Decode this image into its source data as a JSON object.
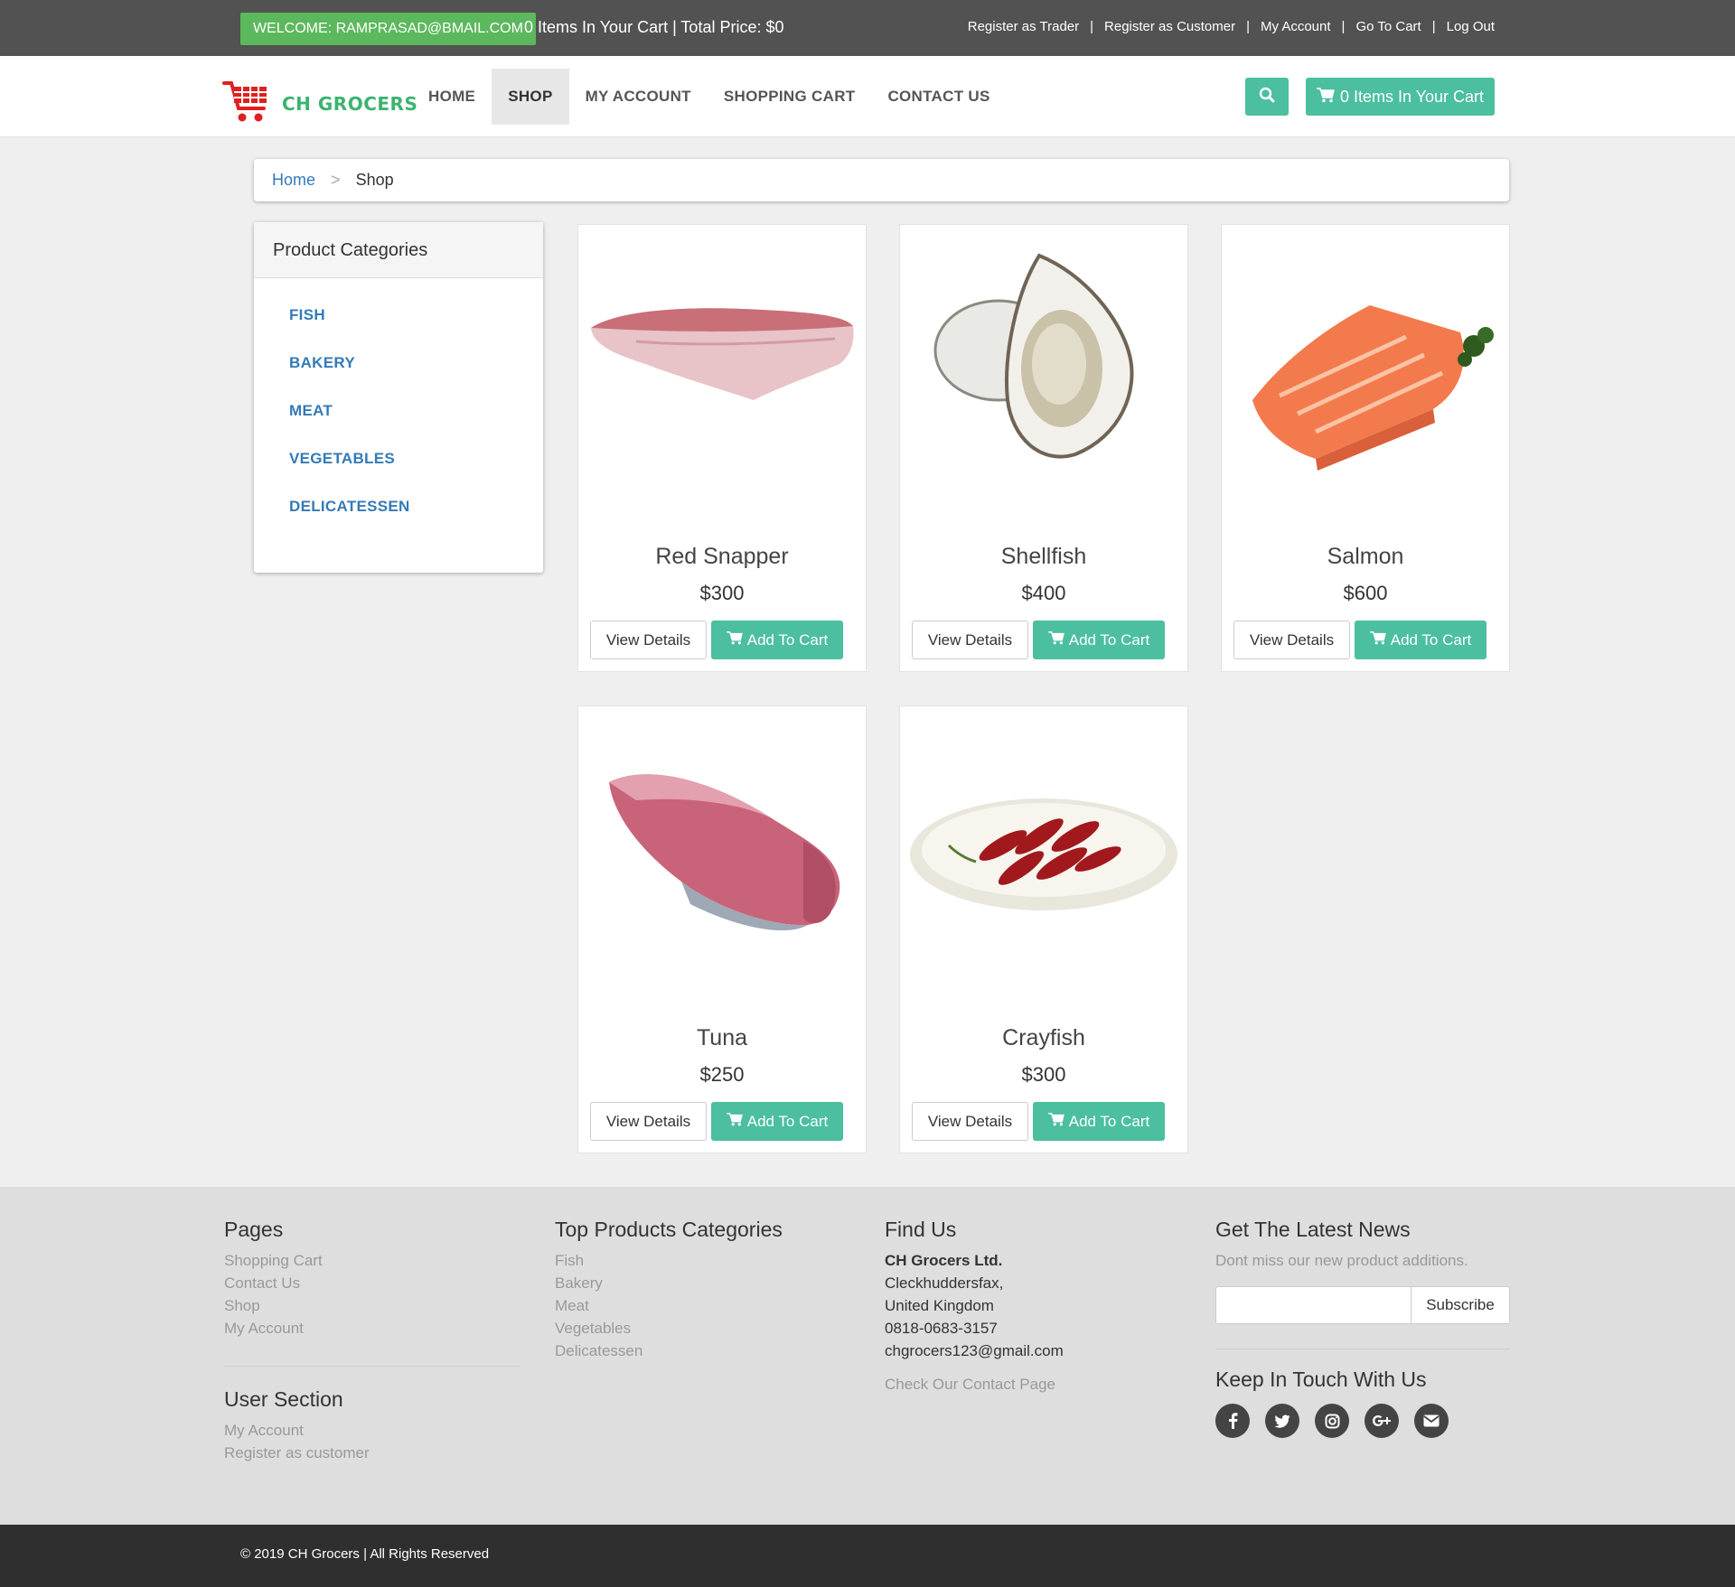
{
  "topbar": {
    "welcome": "WELCOME: RAMPRASAD@BMAIL.COM",
    "cart_summary": "0 Items In Your Cart | Total Price: $0",
    "links": [
      "Register as Trader",
      "Register as Customer",
      "My Account",
      "Go To Cart",
      "Log Out"
    ],
    "separator": "|"
  },
  "nav": {
    "brand": "CH GROCERS",
    "menu": [
      "HOME",
      "SHOP",
      "MY ACCOUNT",
      "SHOPPING CART",
      "CONTACT US"
    ],
    "active": "SHOP",
    "cart_button": "0 Items In Your Cart"
  },
  "breadcrumb": {
    "home": "Home",
    "separator": ">",
    "current": "Shop"
  },
  "sidebar": {
    "title": "Product Categories",
    "categories": [
      "FISH",
      "BAKERY",
      "MEAT",
      "VEGETABLES",
      "DELICATESSEN"
    ]
  },
  "products": [
    {
      "name": "Red Snapper",
      "price": "$300",
      "image": "red-snapper-fillet"
    },
    {
      "name": "Shellfish",
      "price": "$400",
      "image": "oyster"
    },
    {
      "name": "Salmon",
      "price": "$600",
      "image": "salmon-fillet"
    },
    {
      "name": "Tuna",
      "price": "$250",
      "image": "tuna-loin"
    },
    {
      "name": "Crayfish",
      "price": "$300",
      "image": "crayfish-plate"
    }
  ],
  "card_buttons": {
    "details": "View Details",
    "add": "Add To Cart"
  },
  "footer": {
    "pages": {
      "title": "Pages",
      "links": [
        "Shopping Cart",
        "Contact Us",
        "Shop",
        "My Account"
      ]
    },
    "user_section": {
      "title": "User Section",
      "links": [
        "My Account",
        "Register as customer"
      ]
    },
    "top_categories": {
      "title": "Top Products Categories",
      "links": [
        "Fish",
        "Bakery",
        "Meat",
        "Vegetables",
        "Delicatessen"
      ]
    },
    "find_us": {
      "title": "Find Us",
      "company": "CH Grocers Ltd.",
      "lines": [
        "Cleckhuddersfax,",
        "United Kingdom",
        "0818-0683-3157",
        "chgrocers123@gmail.com"
      ],
      "contact_link": "Check Our Contact Page"
    },
    "news": {
      "title": "Get The Latest News",
      "text": "Dont miss our new product additions.",
      "subscribe": "Subscribe",
      "input_value": ""
    },
    "keep_in_touch": {
      "title": "Keep In Touch With Us",
      "icons": [
        "facebook-icon",
        "twitter-icon",
        "instagram-icon",
        "google-plus-icon",
        "envelope-icon"
      ]
    }
  },
  "copyright": "© 2019 CH Grocers | All Rights Reserved",
  "colors": {
    "accent": "#4bbf9f",
    "welcome": "#5cb85c",
    "brand": "#3cb371",
    "link": "#337ab7",
    "topbar": "#525252"
  }
}
